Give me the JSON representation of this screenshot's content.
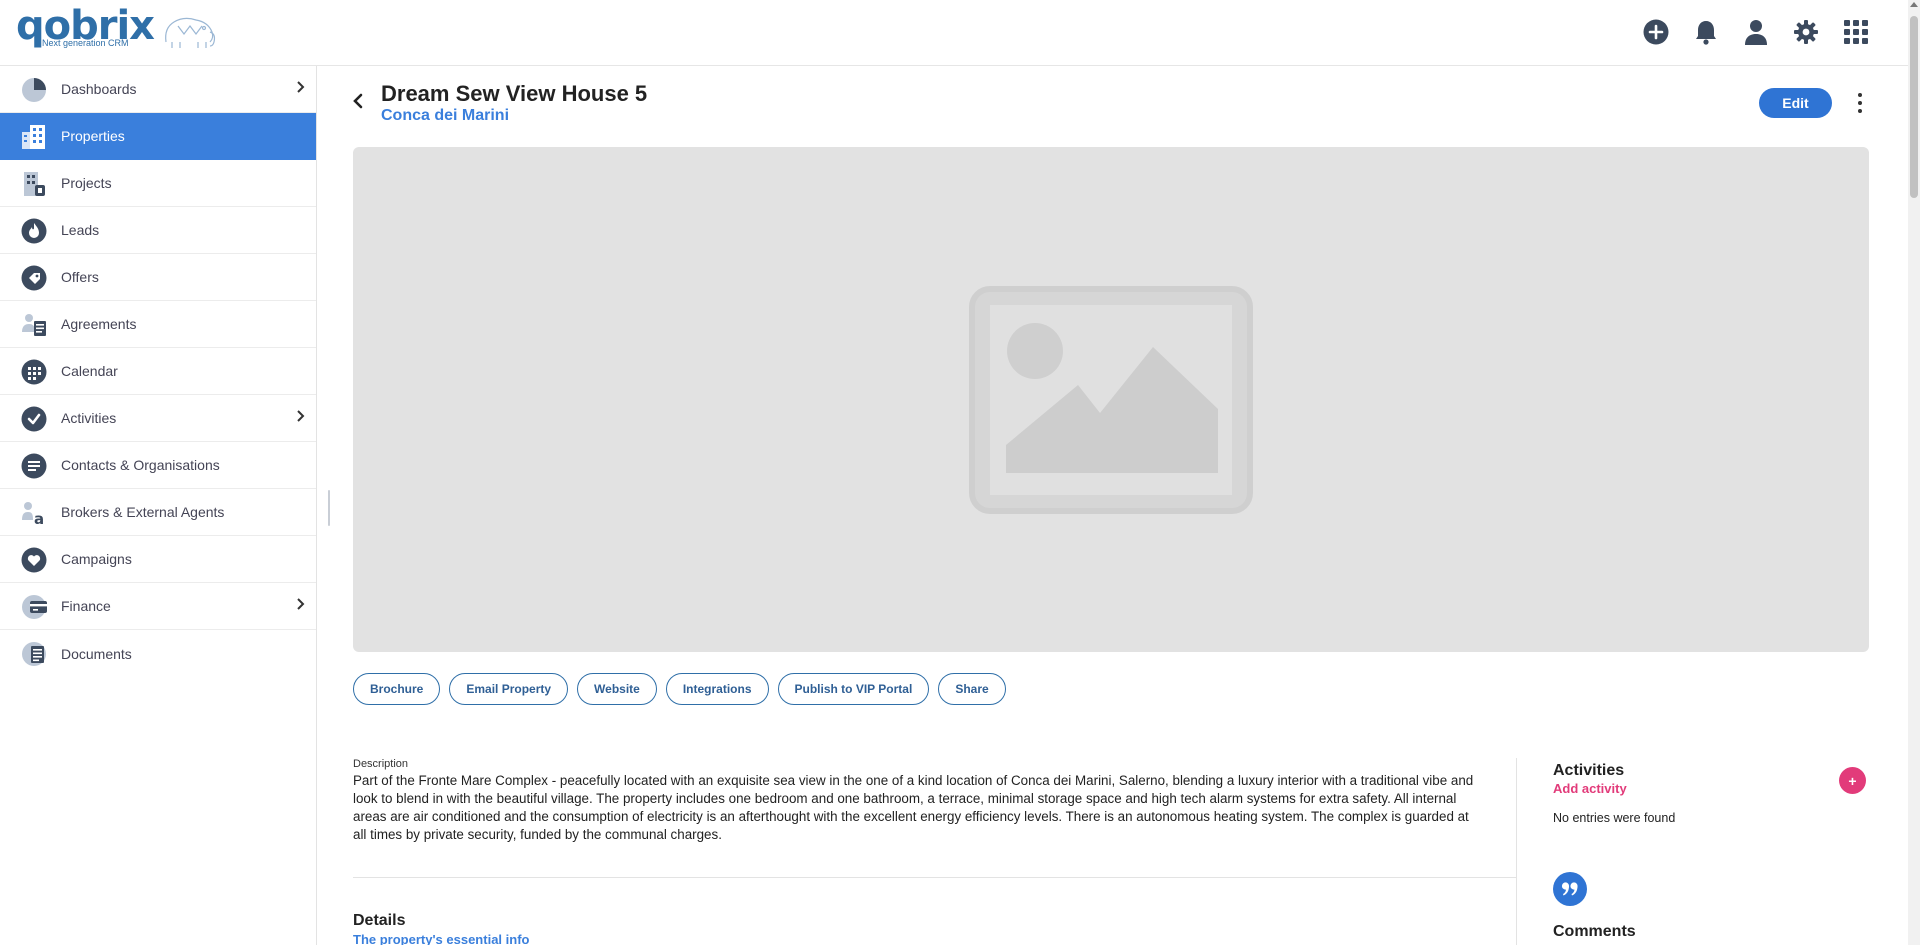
{
  "app": {
    "logo_text": "qobrix",
    "logo_tagline": "Next generation CRM",
    "brand_color": "#2f6fa8",
    "accent_color": "#3a7fdc",
    "pink_color": "#e23b7a"
  },
  "topbar": {
    "icons": [
      "add-circle-icon",
      "bell-icon",
      "user-icon",
      "gear-icon",
      "apps-grid-icon"
    ]
  },
  "sidebar": {
    "items": [
      {
        "label": "Dashboards",
        "icon": "pie-chart-icon",
        "has_submenu": true,
        "active": false
      },
      {
        "label": "Properties",
        "icon": "buildings-icon",
        "has_submenu": false,
        "active": true
      },
      {
        "label": "Projects",
        "icon": "project-building-icon",
        "has_submenu": false,
        "active": false
      },
      {
        "label": "Leads",
        "icon": "flame-icon",
        "has_submenu": false,
        "active": false
      },
      {
        "label": "Offers",
        "icon": "tag-icon",
        "has_submenu": false,
        "active": false
      },
      {
        "label": "Agreements",
        "icon": "agreement-icon",
        "has_submenu": false,
        "active": false
      },
      {
        "label": "Calendar",
        "icon": "calendar-icon",
        "has_submenu": false,
        "active": false
      },
      {
        "label": "Activities",
        "icon": "check-circle-icon",
        "has_submenu": true,
        "active": false
      },
      {
        "label": "Contacts & Organisations",
        "icon": "contacts-icon",
        "has_submenu": false,
        "active": false
      },
      {
        "label": "Brokers & External Agents",
        "icon": "broker-icon",
        "has_submenu": false,
        "active": false
      },
      {
        "label": "Campaigns",
        "icon": "heart-icon",
        "has_submenu": false,
        "active": false
      },
      {
        "label": "Finance",
        "icon": "finance-icon",
        "has_submenu": true,
        "active": false
      },
      {
        "label": "Documents",
        "icon": "documents-icon",
        "has_submenu": false,
        "active": false
      }
    ]
  },
  "property": {
    "title": "Dream Sew View House 5",
    "location": "Conca dei Marini",
    "edit_label": "Edit",
    "image_placeholder_icon": "image-placeholder-icon"
  },
  "actions": [
    "Brochure",
    "Email Property",
    "Website",
    "Integrations",
    "Publish to VIP Portal",
    "Share"
  ],
  "description": {
    "label": "Description",
    "text": "Part of the Fronte Mare Complex - peacefully located with an exquisite sea view in the one of a kind location of Conca dei Marini, Salerno, blending a luxury interior with a traditional vibe and look to blend in with the beautiful village. The property includes one bedroom and one bathroom, a terrace, minimal storage space and high tech alarm systems for extra safety. All internal areas are air conditioned and the consumption of electricity is an afterthought with the excellent energy efficiency levels. There is an autonomous heating system. The complex is guarded at all times by private security, funded by the communal charges."
  },
  "details": {
    "heading": "Details",
    "subheading": "The property's essential info"
  },
  "activities": {
    "heading": "Activities",
    "add_label": "Add activity",
    "plus_label": "+",
    "empty_text": "No entries were found"
  },
  "comments": {
    "heading": "Comments"
  }
}
